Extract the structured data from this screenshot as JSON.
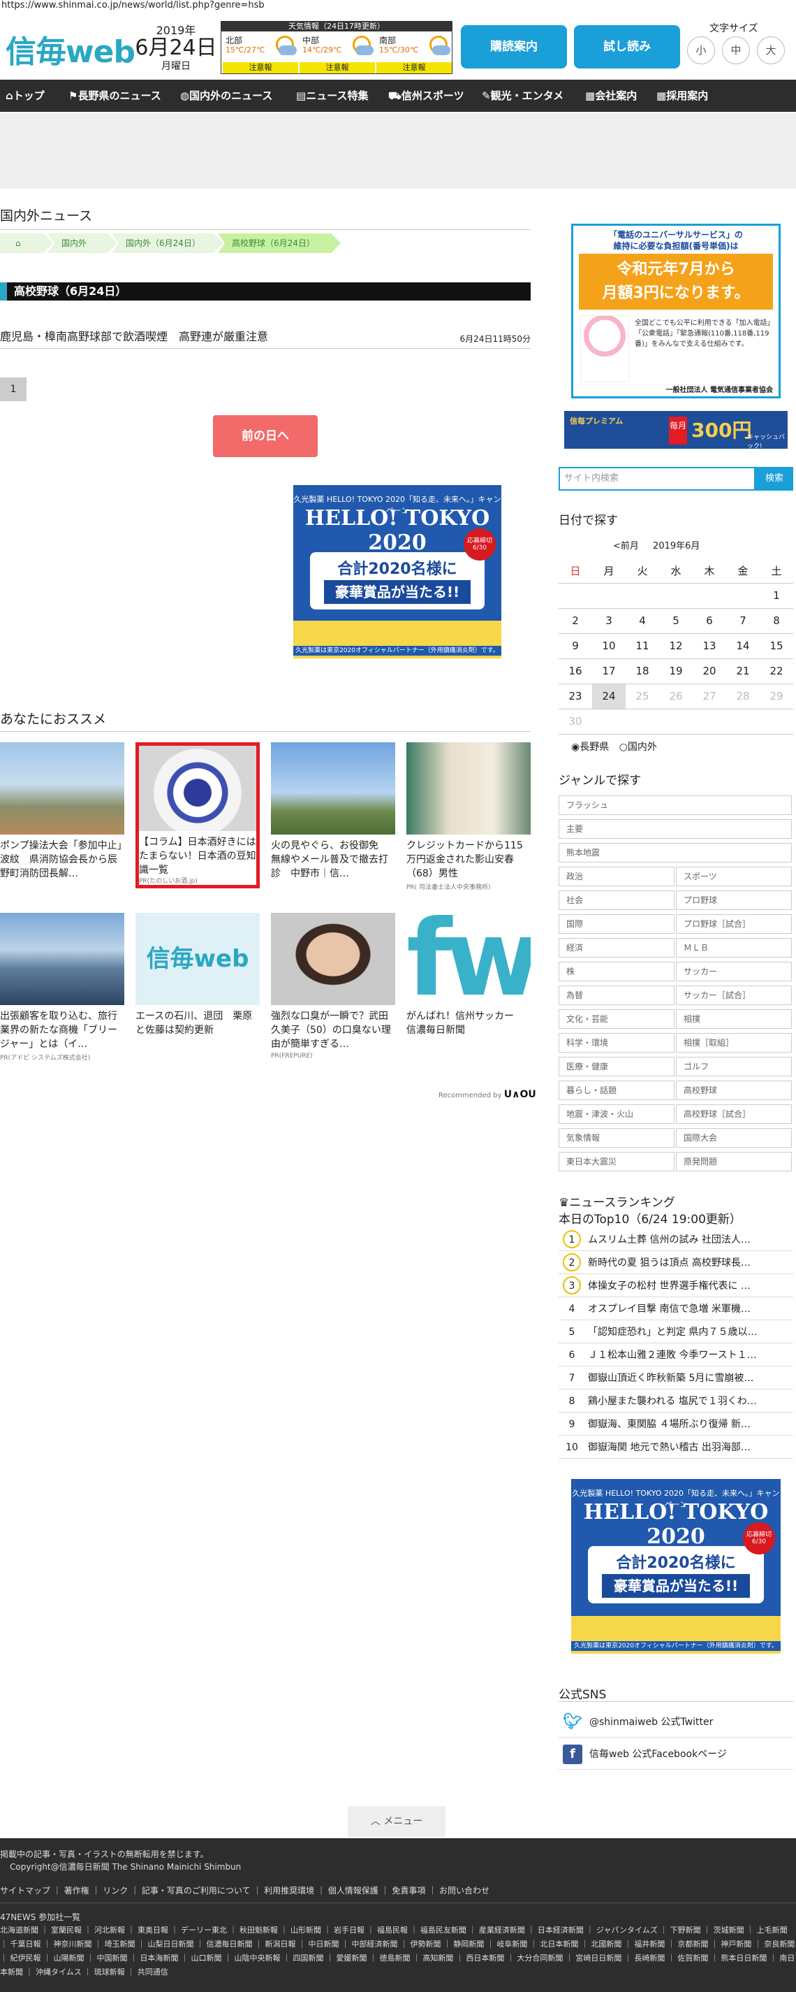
{
  "url": "https://www.shinmai.co.jp/news/world/list.php?genre=hsb",
  "header": {
    "logo": "信毎web",
    "date": {
      "year": "2019年",
      "month_day": "6月24日",
      "weekday": "月曜日"
    },
    "weather": {
      "title": "天気情報（24日17時更新）",
      "regions": [
        {
          "name": "北部",
          "temp": "15℃/27℃",
          "warning": "注意報"
        },
        {
          "name": "中部",
          "temp": "14℃/29℃",
          "warning": "注意報"
        },
        {
          "name": "南部",
          "temp": "15℃/30℃",
          "warning": "注意報"
        }
      ]
    },
    "btn_subscribe": "購読案内",
    "btn_trial": "試し読み",
    "font_size_label": "文字サイズ",
    "font_sizes": [
      "小",
      "中",
      "大"
    ]
  },
  "nav": [
    "トップ",
    "長野県のニュース",
    "国内外のニュース",
    "ニュース特集",
    "信州スポーツ",
    "観光・エンタメ",
    "会社案内",
    "採用案内"
  ],
  "main": {
    "section_title": "国内外ニュース",
    "breadcrumb": [
      "国内外",
      "国内外（6月24日）",
      "高校野球（6月24日）"
    ],
    "genre_title": "高校野球（6月24日）",
    "article": {
      "title": "鹿児島・樟南高野球部で飲酒喫煙　高野連が厳重注意",
      "time": "6月24日11時50分"
    },
    "page_number": "1",
    "prev_day": "前の日へ"
  },
  "tokyo_ad": {
    "top": "久光製薬 HELLO! TOKYO 2020「知る走、未来へ。」キャンペーン",
    "headline": "HELLO! TOKYO 2020",
    "line1": "合計2020名様に",
    "line2": "豪華賞品が当たる!!",
    "badge": "応募締切 6/30",
    "foot": "久光製薬は東京2020オフィシャルパートナー（外用鎮痛消炎剤）です。"
  },
  "recommend": {
    "title": "あなたにおススメ",
    "cards": [
      {
        "caption": "ポンプ操法大会「参加中止」波紋　県消防協会長から辰野町消防団長解…",
        "pr": ""
      },
      {
        "caption": "【コラム】日本酒好きにはたまらない！日本酒の豆知識一覧",
        "pr": "PR(たのしいお酒.jp)"
      },
      {
        "caption": "火の見やぐら、お役御免　無線やメール普及で撤去打診　中野市｜信…",
        "pr": ""
      },
      {
        "caption": "クレジットカードから115万円返金された影山安春（68）男性",
        "pr": "PR( 司法書士法人中央事務所)"
      },
      {
        "caption": "出張顧客を取り込む、旅行業界の新たな商機「ブリージャー」とは（イ…",
        "pr": "PR(アドビ システムズ株式会社)"
      },
      {
        "caption": "エースの石川、退団　栗原と佐藤は契約更新",
        "pr": ""
      },
      {
        "caption": "強烈な口臭が一瞬で？武田久美子（50）の口臭ない理由が簡単すぎる…",
        "pr": "PR(FREPURE)"
      },
      {
        "caption": "がんばれ！信州サッカー　信濃毎日新聞",
        "pr": ""
      }
    ],
    "recommended_by": "Recommended by",
    "brand": "U∧OU"
  },
  "sidebar": {
    "ad1": {
      "line1": "「電話のユニバーサルサービス」の",
      "line2": "維持に必要な負担額(番号単価)は",
      "big1": "令和元年7月から",
      "big2": "月額3円になります。",
      "body": "全国どこでも公平に利用できる「加入電話」「公衆電話」「緊急通報(110番,118番,119番)」をみんなで支える仕組みです。",
      "org": "一般社団法人 電気通信事業者協会"
    },
    "ad2": {
      "left": "信毎プレミアム",
      "mid": "毎月",
      "big": "300円",
      "right": "キャッシュバック!"
    },
    "search_placeholder": "サイト内検索",
    "search_button": "検索",
    "calendar_title": "日付で探す",
    "calendar_prev": "<前月",
    "calendar_month": "2019年6月",
    "weekdays": [
      "日",
      "月",
      "火",
      "水",
      "木",
      "金",
      "土"
    ],
    "weeks": [
      [
        "",
        "",
        "",
        "",
        "",
        "",
        "1"
      ],
      [
        "2",
        "3",
        "4",
        "5",
        "6",
        "7",
        "8"
      ],
      [
        "9",
        "10",
        "11",
        "12",
        "13",
        "14",
        "15"
      ],
      [
        "16",
        "17",
        "18",
        "19",
        "20",
        "21",
        "22"
      ],
      [
        "23",
        "24",
        "25",
        "26",
        "27",
        "28",
        "29"
      ],
      [
        "30",
        "",
        "",
        "",
        "",
        "",
        ""
      ]
    ],
    "radio": [
      "長野県",
      "国内外"
    ],
    "genre_title": "ジャンルで探す",
    "genres_full": [
      "フラッシュ",
      "主要",
      "熊本地震"
    ],
    "genres_pairs": [
      [
        "政治",
        "スポーツ"
      ],
      [
        "社会",
        "プロ野球"
      ],
      [
        "国際",
        "プロ野球［試合］"
      ],
      [
        "経済",
        "ＭＬＢ"
      ],
      [
        "株",
        "サッカー"
      ],
      [
        "為替",
        "サッカー［試合］"
      ],
      [
        "文化・芸能",
        "相撲"
      ],
      [
        "科学・環境",
        "相撲［取組］"
      ],
      [
        "医療・健康",
        "ゴルフ"
      ],
      [
        "暮らし・話題",
        "高校野球"
      ],
      [
        "地震・津波・火山",
        "高校野球［試合］"
      ],
      [
        "気象情報",
        "国際大会"
      ],
      [
        "東日本大震災",
        "原発問題"
      ]
    ],
    "ranking_title": "ニュースランキング",
    "ranking_sub": "本日のTop10（6/24 19:00更新）",
    "ranking": [
      "ムスリム土葬 信州の試み 社団法人…",
      "新時代の夏 狙うは頂点 高校野球長…",
      "体操女子の松村 世界選手権代表に …",
      "オスプレイ目撃 南信で急増 米軍機…",
      "「認知症恐れ」と判定 県内７５歳以…",
      "Ｊ１松本山雅２連敗 今季ワースト１…",
      "御嶽山頂近く昨秋新築 5月に雪崩被…",
      "鶏小屋また襲われる 塩尻で１羽くわ…",
      "御嶽海、東関脇 ４場所ぶり復帰 新…",
      "御嶽海関 地元で熱い稽古 出羽海部…"
    ],
    "sns_title": "公式SNS",
    "sns": [
      "@shinmaiweb 公式Twitter",
      "信毎web 公式Facebookページ"
    ]
  },
  "menu_tab": "メニュー",
  "footer": {
    "notice": "掲載中の記事・写真・イラストの無断転用を禁じます。",
    "copyright": "Copyright@信濃毎日新聞 The Shinano Mainichi Shimbun",
    "links": "サイトマップ ｜ 著作権 ｜ リンク ｜ 記事・写真のご利用について ｜ 利用推奨環境 ｜ 個人情報保護 ｜ 免責事項 ｜ お問い合わせ",
    "news47_title": "47NEWS 参加社一覧",
    "news47": "北海道新聞 ｜ 室蘭民報 ｜ 河北新報 ｜ 東奥日報 ｜ デーリー東北 ｜ 秋田魁新報 ｜ 山形新聞 ｜ 岩手日報 ｜ 福島民報 ｜ 福島民友新聞 ｜ 産業経済新聞 ｜ 日本経済新聞 ｜ ジャパンタイムズ ｜ 下野新聞 ｜ 茨城新聞 ｜ 上毛新聞 ｜ 千葉日報 ｜ 神奈川新聞 ｜ 埼玉新聞 ｜ 山梨日日新聞 ｜ 信濃毎日新聞 ｜ 新潟日報 ｜ 中日新聞 ｜ 中部経済新聞 ｜ 伊勢新聞 ｜ 静岡新聞 ｜ 岐阜新聞 ｜ 北日本新聞 ｜ 北國新聞 ｜ 福井新聞 ｜ 京都新聞 ｜ 神戸新聞 ｜ 奈良新聞 ｜ 紀伊民報 ｜ 山陽新聞 ｜ 中国新聞 ｜ 日本海新聞 ｜ 山口新聞 ｜ 山陰中央新報 ｜ 四国新聞 ｜ 愛媛新聞 ｜ 徳島新聞 ｜ 高知新聞 ｜ 西日本新聞 ｜ 大分合同新聞 ｜ 宮崎日日新聞 ｜ 長崎新聞 ｜ 佐賀新聞 ｜ 熊本日日新聞 ｜ 南日本新聞 ｜ 沖縄タイムス ｜ 琉球新報 ｜ 共同通信"
  }
}
